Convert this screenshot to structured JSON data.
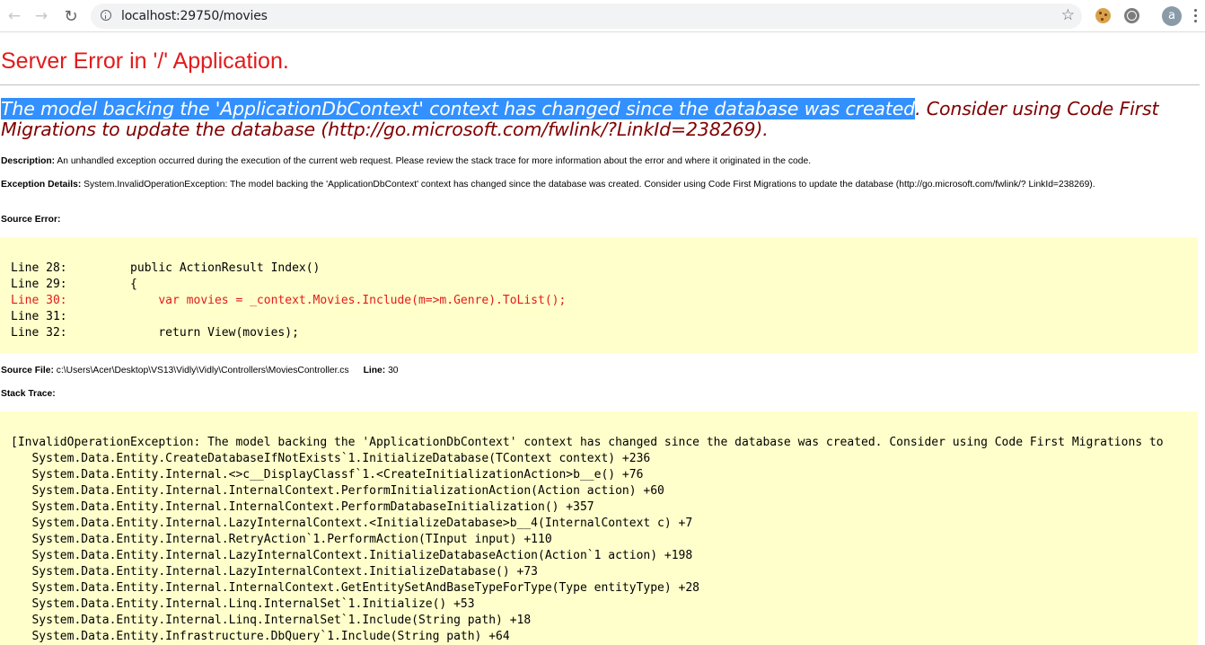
{
  "browser": {
    "url": "localhost:29750/movies",
    "avatar_letter": "a",
    "icons": [
      "back-icon",
      "forward-icon",
      "reload-icon",
      "info-icon",
      "star-icon",
      "cookie-icon",
      "globe-icon",
      "menu-icon"
    ]
  },
  "page": {
    "title": "Server Error in '/' Application.",
    "message_selected": "The model backing the 'ApplicationDbContext' context has changed since the database was created",
    "message_rest": ". Consider using Code First Migrations to update the database (http://go.microsoft.com/fwlink/?LinkId=238269).",
    "description_label": "Description:",
    "description_text": " An unhandled exception occurred during the execution of the current web request. Please review the stack trace for more information about the error and where it originated in the code.",
    "exception_label": "Exception Details:",
    "exception_text": " System.InvalidOperationException: The model backing the 'ApplicationDbContext' context has changed since the database was created. Consider using Code First Migrations to update the database (http://go.microsoft.com/fwlink/? LinkId=238269).",
    "source_error_label": "Source Error:",
    "source_lines": [
      {
        "text": "Line 28:         public ActionResult Index()",
        "error": false
      },
      {
        "text": "Line 29:         {",
        "error": false
      },
      {
        "text": "Line 30:             var movies = _context.Movies.Include(m=>m.Genre).ToList();",
        "error": true
      },
      {
        "text": "Line 31:",
        "error": false
      },
      {
        "text": "Line 32:             return View(movies);",
        "error": false
      }
    ],
    "source_file_label": "Source File:",
    "source_file_value": " c:\\Users\\Acer\\Desktop\\VS13\\Vidly\\Vidly\\Controllers\\MoviesController.cs",
    "line_label": "Line:",
    "line_value": " 30",
    "stack_trace_label": "Stack Trace:",
    "stack_lines": [
      "[InvalidOperationException: The model backing the 'ApplicationDbContext' context has changed since the database was created. Consider using Code First Migrations to",
      "   System.Data.Entity.CreateDatabaseIfNotExists`1.InitializeDatabase(TContext context) +236",
      "   System.Data.Entity.Internal.<>c__DisplayClassf`1.<CreateInitializationAction>b__e() +76",
      "   System.Data.Entity.Internal.InternalContext.PerformInitializationAction(Action action) +60",
      "   System.Data.Entity.Internal.InternalContext.PerformDatabaseInitialization() +357",
      "   System.Data.Entity.Internal.LazyInternalContext.<InitializeDatabase>b__4(InternalContext c) +7",
      "   System.Data.Entity.Internal.RetryAction`1.PerformAction(TInput input) +110",
      "   System.Data.Entity.Internal.LazyInternalContext.InitializeDatabaseAction(Action`1 action) +198",
      "   System.Data.Entity.Internal.LazyInternalContext.InitializeDatabase() +73",
      "   System.Data.Entity.Internal.InternalContext.GetEntitySetAndBaseTypeForType(Type entityType) +28",
      "   System.Data.Entity.Internal.Linq.InternalSet`1.Initialize() +53",
      "   System.Data.Entity.Internal.Linq.InternalSet`1.Include(String path) +18",
      "   System.Data.Entity.Infrastructure.DbQuery`1.Include(String path) +64"
    ]
  }
}
